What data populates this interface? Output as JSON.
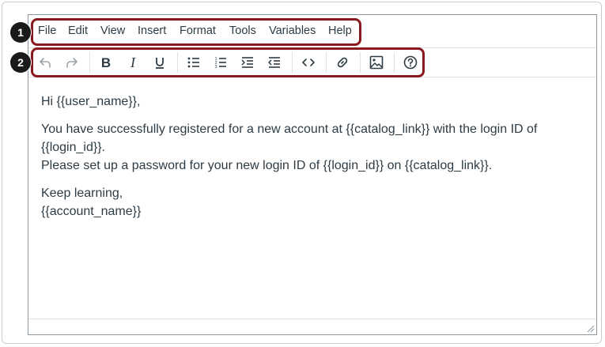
{
  "menubar": {
    "items": [
      "File",
      "Edit",
      "View",
      "Insert",
      "Format",
      "Tools",
      "Variables",
      "Help"
    ]
  },
  "toolbar": {
    "buttons": [
      {
        "icon": "undo-icon",
        "name": "undo-button",
        "disabled": true
      },
      {
        "icon": "redo-icon",
        "name": "redo-button",
        "disabled": true
      },
      {
        "icon": "bold-icon",
        "name": "bold-button"
      },
      {
        "icon": "italic-icon",
        "name": "italic-button"
      },
      {
        "icon": "underline-icon",
        "name": "underline-button"
      },
      {
        "icon": "bulleted-list-icon",
        "name": "bulleted-list-button"
      },
      {
        "icon": "numbered-list-icon",
        "name": "numbered-list-button"
      },
      {
        "icon": "indent-icon",
        "name": "indent-button"
      },
      {
        "icon": "outdent-icon",
        "name": "outdent-button"
      },
      {
        "icon": "code-icon",
        "name": "html-editor-button"
      },
      {
        "icon": "link-icon",
        "name": "link-button"
      },
      {
        "icon": "image-icon",
        "name": "image-button"
      },
      {
        "icon": "help-circle-icon",
        "name": "help-button"
      }
    ]
  },
  "body": {
    "greeting": "Hi {{user_name}},",
    "line1": "You have successfully registered for a new account at {{catalog_link}} with the login ID of",
    "line2": "{{login_id}}.",
    "line3": "Please set up a password for your new login ID of {{login_id}} on {{catalog_link}}.",
    "signoff": "Keep learning,",
    "signature": "{{account_name}}"
  },
  "callouts": [
    "1",
    "2"
  ],
  "colors": {
    "callout_border": "#8b1a1f",
    "callout_badge": "#1a1a1a",
    "text": "#2d3b45"
  }
}
